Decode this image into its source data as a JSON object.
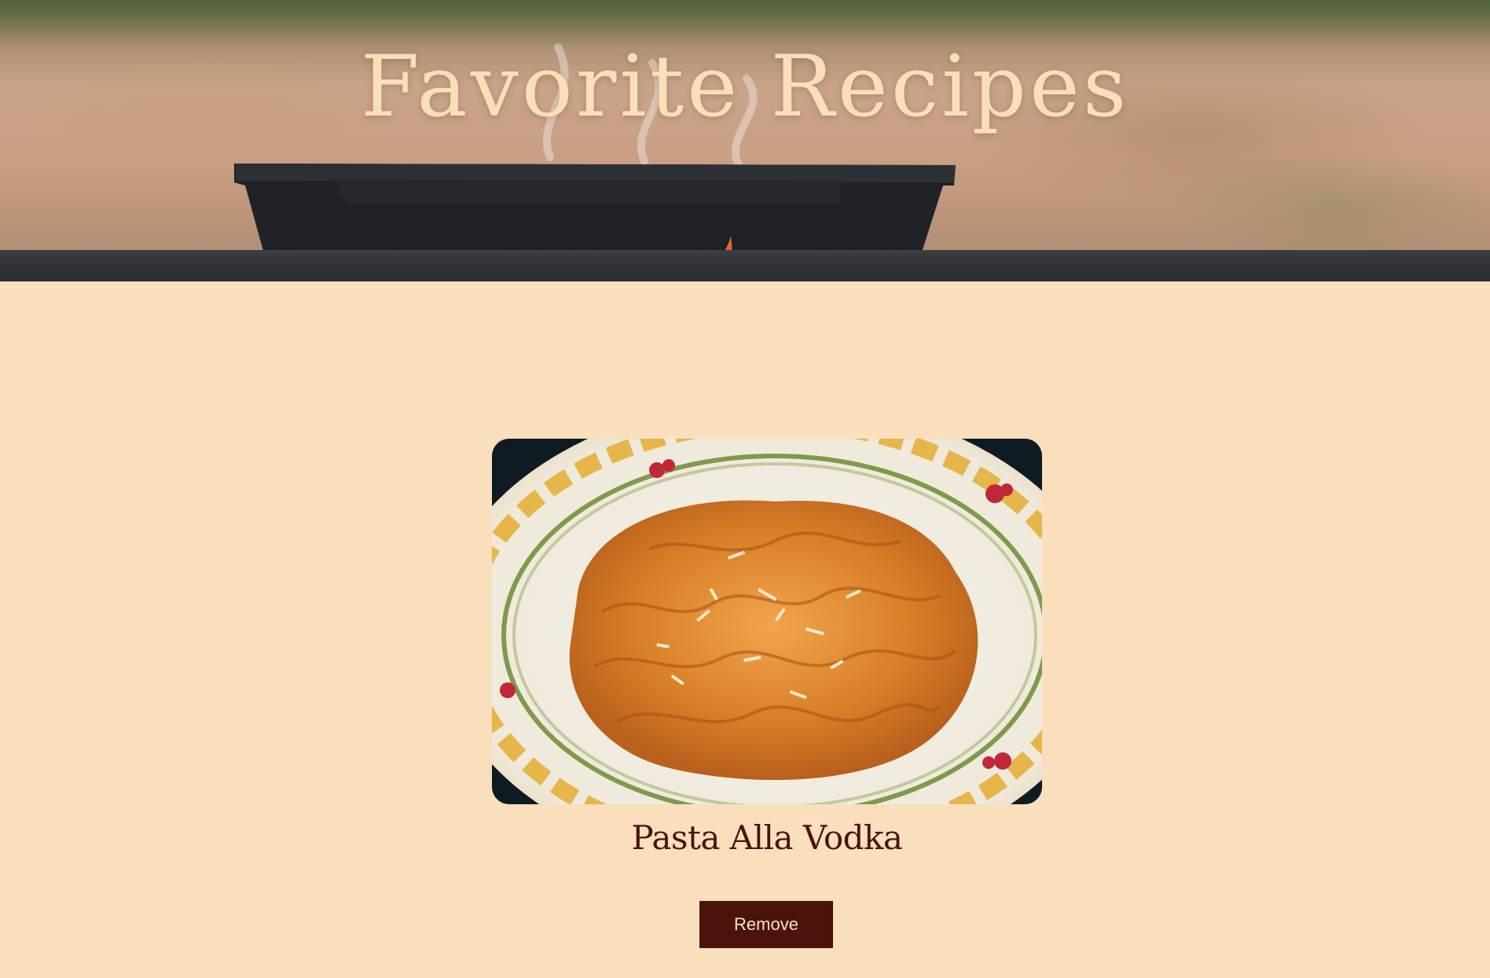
{
  "header": {
    "title": "Favorite Recipes"
  },
  "recipes": [
    {
      "name": "Pasta Alla Vodka",
      "image_alt": "Pasta Alla Vodka",
      "remove_label": "Remove"
    }
  ],
  "colors": {
    "page_background": "#f9dfbc",
    "title_text": "#f8dfb8",
    "recipe_title": "#4a140b",
    "button_background": "#4b1309",
    "button_text": "#f9e2c4"
  }
}
